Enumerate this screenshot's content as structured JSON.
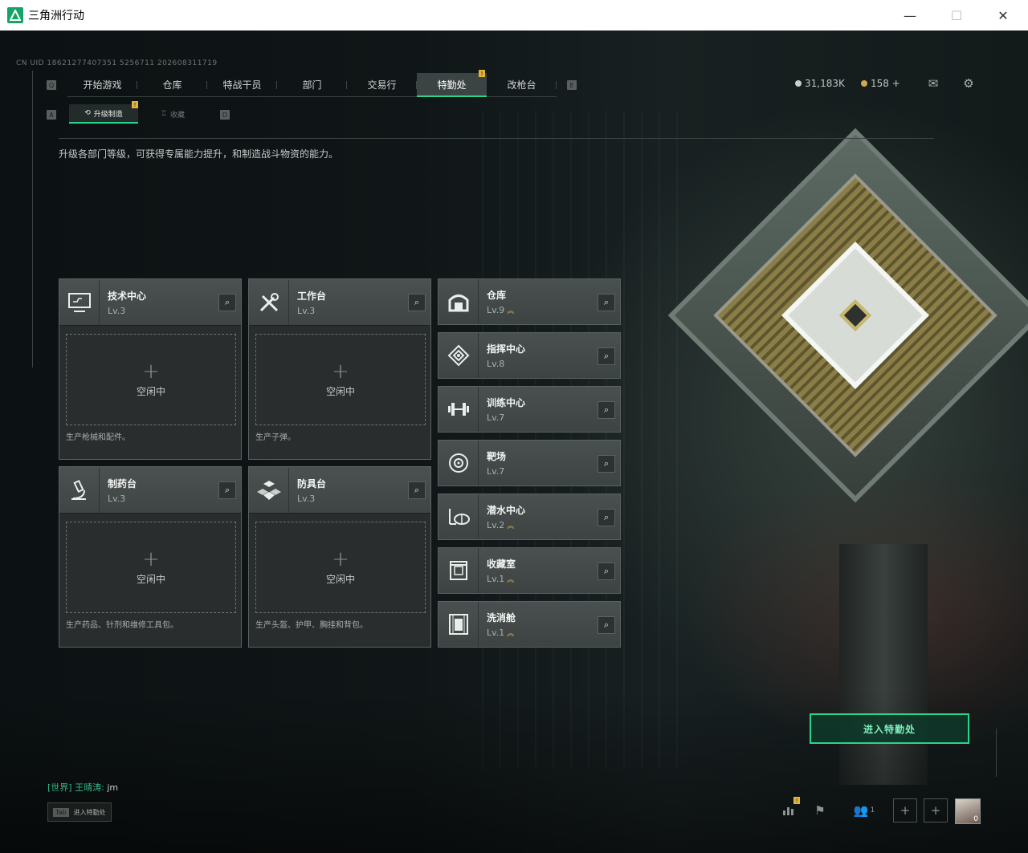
{
  "window": {
    "title": "三角洲行动",
    "minimize": "—",
    "maximize": "☐",
    "close": "✕"
  },
  "uid": "CN UID 18621277407351 5256711 202608311719",
  "key_hints": {
    "left_tab": "Q",
    "right_tab": "E",
    "left_sub": "A",
    "right_sub": "D"
  },
  "tabs": [
    {
      "label": "开始游戏",
      "active": false
    },
    {
      "label": "仓库",
      "active": false
    },
    {
      "label": "特战干员",
      "active": false
    },
    {
      "label": "部门",
      "active": false
    },
    {
      "label": "交易行",
      "active": false
    },
    {
      "label": "特勤处",
      "active": true,
      "badge": "!"
    },
    {
      "label": "改枪台",
      "active": false
    }
  ],
  "currency": {
    "coins": "31,183K",
    "tokens": "158 +"
  },
  "subtabs": [
    {
      "label": "升级制造",
      "active": true,
      "badge": "!"
    },
    {
      "label": "收藏",
      "active": false
    }
  ],
  "description": "升级各部门等级，可获得专属能力提升，和制造战斗物资的能力。",
  "production": [
    {
      "name": "技术中心",
      "level": "Lv.3",
      "status": "空闲中",
      "desc": "生产枪械和配件。",
      "icon": "computer-icon"
    },
    {
      "name": "工作台",
      "level": "Lv.3",
      "status": "空闲中",
      "desc": "生产子弹。",
      "icon": "tools-icon"
    },
    {
      "name": "制药台",
      "level": "Lv.3",
      "status": "空闲中",
      "desc": "生产药品、针剂和维修工具包。",
      "icon": "microscope-icon"
    },
    {
      "name": "防具台",
      "level": "Lv.3",
      "status": "空闲中",
      "desc": "生产头盔、护甲、胸挂和背包。",
      "icon": "armor-icon"
    }
  ],
  "buildings": [
    {
      "name": "仓库",
      "level": "Lv.9",
      "upgrade": true,
      "icon": "warehouse-icon"
    },
    {
      "name": "指挥中心",
      "level": "Lv.8",
      "upgrade": false,
      "icon": "command-icon"
    },
    {
      "name": "训练中心",
      "level": "Lv.7",
      "upgrade": false,
      "icon": "dumbbell-icon"
    },
    {
      "name": "靶场",
      "level": "Lv.7",
      "upgrade": false,
      "icon": "target-icon"
    },
    {
      "name": "潜水中心",
      "level": "Lv.2",
      "upgrade": true,
      "icon": "diving-icon"
    },
    {
      "name": "收藏室",
      "level": "Lv.1",
      "upgrade": true,
      "icon": "collection-icon"
    },
    {
      "name": "洗消舱",
      "level": "Lv.1",
      "upgrade": true,
      "icon": "decon-icon"
    }
  ],
  "enter_button": "进入特勤处",
  "chat": {
    "channel": "[世界]",
    "user": "王晴涛:",
    "message": "jm"
  },
  "tab_hint": {
    "key": "Tab",
    "label": "进入特勤处"
  },
  "bottom_right": {
    "friends_count": "1",
    "avatar_count": "0"
  },
  "colors": {
    "accent": "#2bd48d",
    "badge": "#e0b43a",
    "upgrade": "#e3b44a"
  }
}
